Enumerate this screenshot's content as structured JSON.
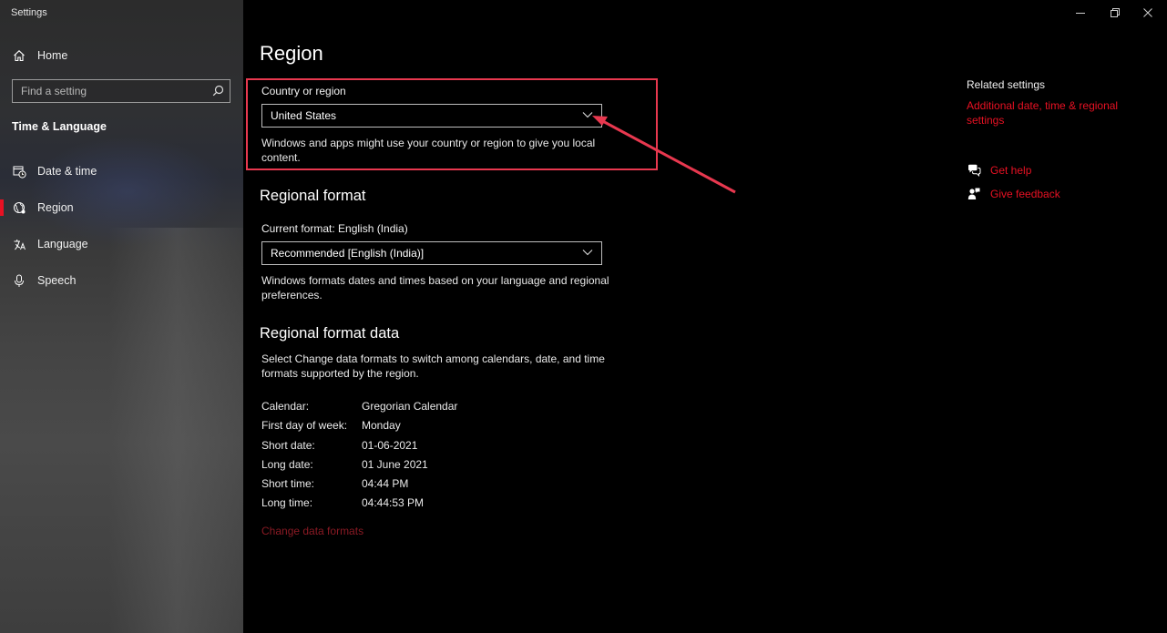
{
  "window": {
    "title": "Settings",
    "controls": {
      "minimize": "—",
      "restore": "❐",
      "close": "✕"
    }
  },
  "sidebar": {
    "home_label": "Home",
    "search_placeholder": "Find a setting",
    "section_heading": "Time & Language",
    "items": [
      {
        "label": "Date & time",
        "icon": "calendar-clock-icon"
      },
      {
        "label": "Region",
        "icon": "globe-region-icon",
        "active": true
      },
      {
        "label": "Language",
        "icon": "language-icon"
      },
      {
        "label": "Speech",
        "icon": "microphone-icon"
      }
    ]
  },
  "main": {
    "title": "Region",
    "country": {
      "label": "Country or region",
      "value": "United States",
      "description": "Windows and apps might use your country or region to give you local content."
    },
    "regional_format": {
      "heading": "Regional format",
      "current_label": "Current format: English (India)",
      "value": "Recommended [English (India)]",
      "description": "Windows formats dates and times based on your language and regional preferences."
    },
    "regional_format_data": {
      "heading": "Regional format data",
      "description": "Select Change data formats to switch among calendars, date, and time formats supported by the region.",
      "rows": [
        {
          "key": "Calendar:",
          "value": "Gregorian Calendar"
        },
        {
          "key": "First day of week:",
          "value": "Monday"
        },
        {
          "key": "Short date:",
          "value": "01-06-2021"
        },
        {
          "key": "Long date:",
          "value": "01 June 2021"
        },
        {
          "key": "Short time:",
          "value": "04:44 PM"
        },
        {
          "key": "Long time:",
          "value": "04:44:53 PM"
        }
      ],
      "change_link": "Change data formats"
    }
  },
  "related": {
    "title": "Related settings",
    "link": "Additional date, time & regional settings",
    "get_help": "Get help",
    "give_feedback": "Give feedback"
  },
  "colors": {
    "accent": "#e81123",
    "annotation": "#e8384f",
    "background": "#000000"
  }
}
